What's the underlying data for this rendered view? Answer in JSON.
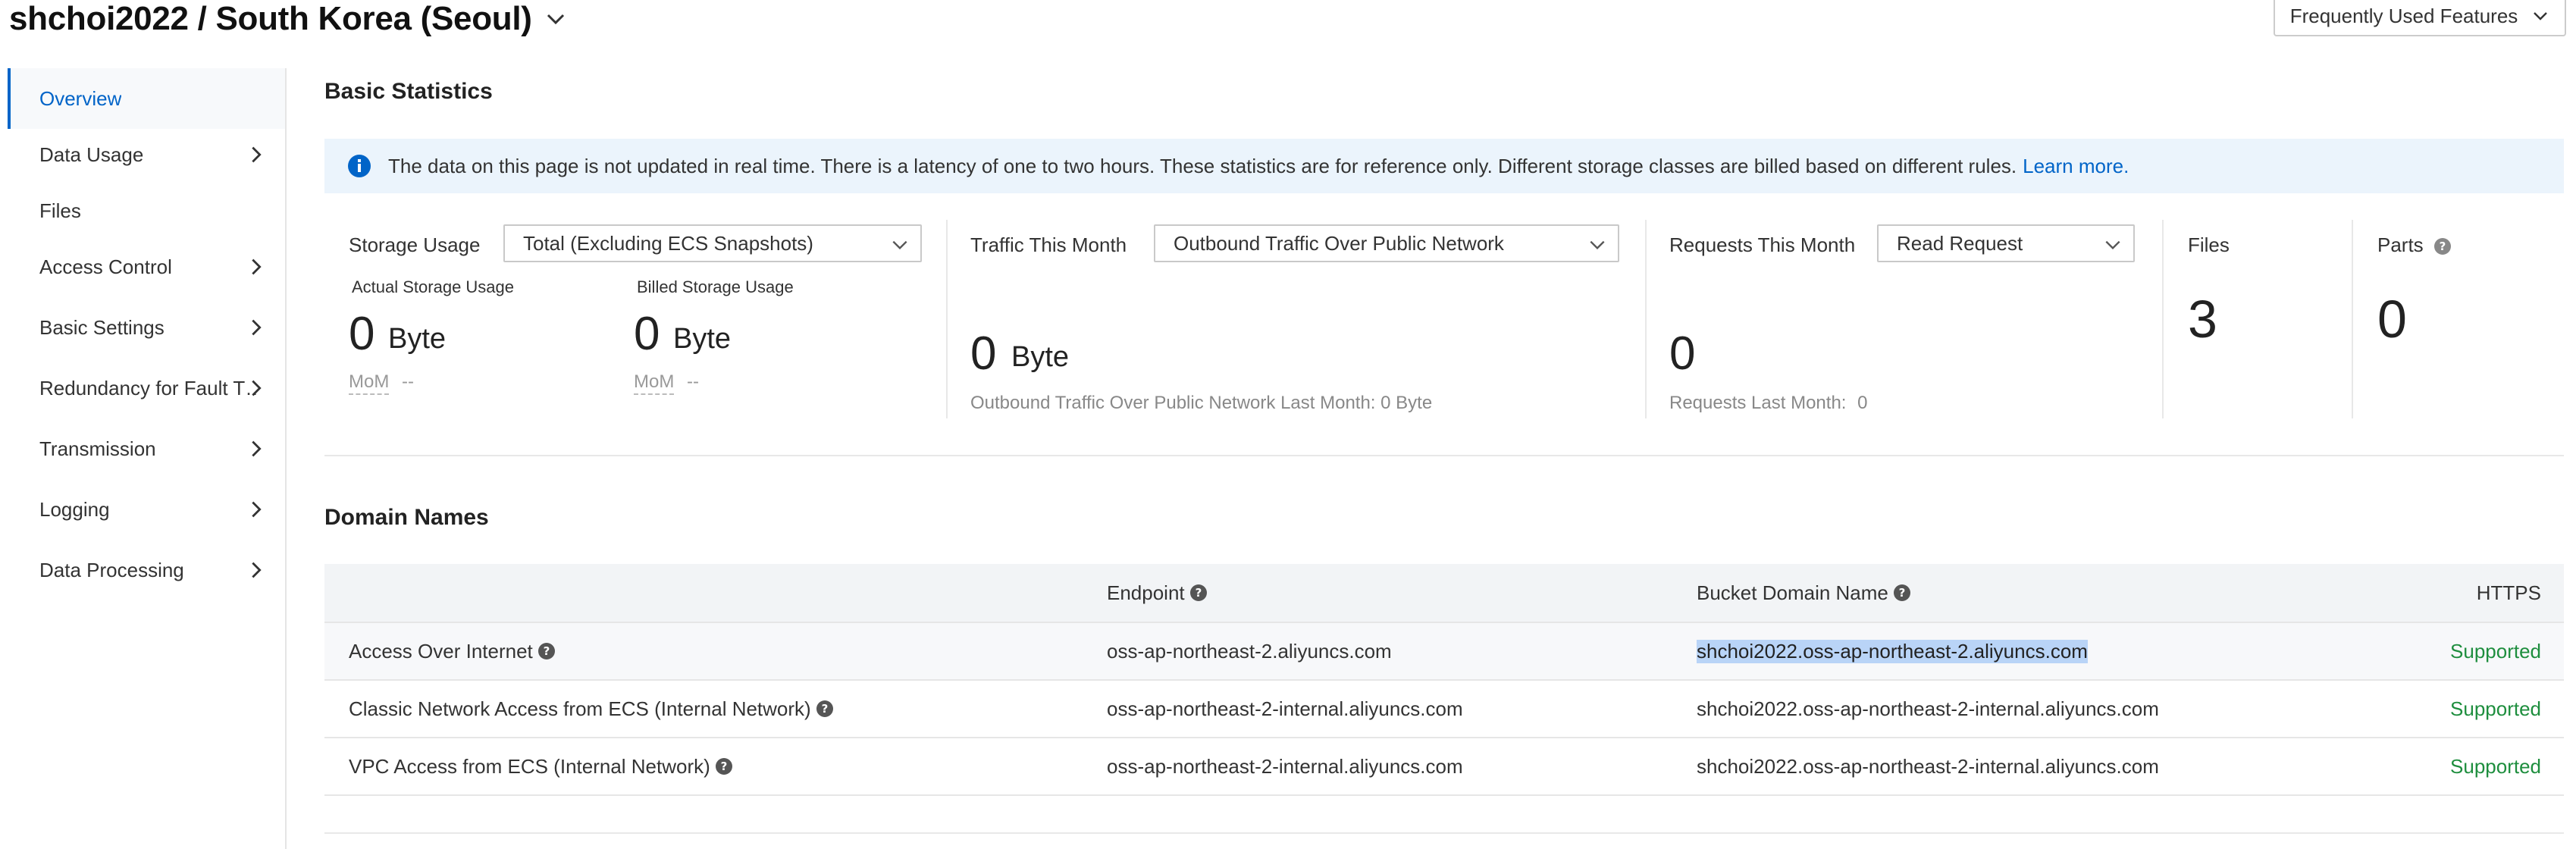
{
  "header": {
    "title": "shchoi2022 / South Korea (Seoul)",
    "frequent_features_label": "Frequently Used Features"
  },
  "sidebar": {
    "items": [
      {
        "label": "Overview",
        "active": true,
        "has_children": false
      },
      {
        "label": "Data Usage",
        "active": false,
        "has_children": true
      },
      {
        "label": "Files",
        "active": false,
        "has_children": false
      },
      {
        "label": "Access Control",
        "active": false,
        "has_children": true
      },
      {
        "label": "Basic Settings",
        "active": false,
        "has_children": true
      },
      {
        "label": "Redundancy for Fault T…",
        "active": false,
        "has_children": true
      },
      {
        "label": "Transmission",
        "active": false,
        "has_children": true
      },
      {
        "label": "Logging",
        "active": false,
        "has_children": true
      },
      {
        "label": "Data Processing",
        "active": false,
        "has_children": true
      }
    ]
  },
  "basic_statistics": {
    "title": "Basic Statistics",
    "notice": {
      "text": "The data on this page is not updated in real time. There is a latency of one to two hours. These statistics are for reference only. Different storage classes are billed based on different rules.",
      "link": "Learn more."
    },
    "storage": {
      "label": "Storage Usage",
      "select_value": "Total (Excluding ECS Snapshots)",
      "actual_label": "Actual Storage Usage",
      "actual_value": "0",
      "actual_unit": "Byte",
      "actual_mom_key": "MoM",
      "actual_mom_value": "--",
      "billed_label": "Billed Storage Usage",
      "billed_value": "0",
      "billed_unit": "Byte",
      "billed_mom_key": "MoM",
      "billed_mom_value": "--"
    },
    "traffic": {
      "label": "Traffic This Month",
      "select_value": "Outbound Traffic Over Public Network",
      "value": "0",
      "unit": "Byte",
      "last_month": "Outbound Traffic Over Public Network Last Month: 0 Byte"
    },
    "requests": {
      "label": "Requests This Month",
      "select_value": "Read Request",
      "value": "0",
      "last_month_label": "Requests Last Month:",
      "last_month_value": "0"
    },
    "files": {
      "label": "Files",
      "value": "3"
    },
    "parts": {
      "label": "Parts",
      "value": "0"
    }
  },
  "domain_names": {
    "title": "Domain Names",
    "columns": {
      "endpoint": "Endpoint",
      "bucket_domain": "Bucket Domain Name",
      "https": "HTTPS"
    },
    "rows": [
      {
        "access": "Access Over Internet",
        "endpoint": "oss-ap-northeast-2.aliyuncs.com",
        "bucket_domain": "shchoi2022.oss-ap-northeast-2.aliyuncs.com",
        "https": "Supported"
      },
      {
        "access": "Classic Network Access from ECS (Internal Network)",
        "endpoint": "oss-ap-northeast-2-internal.aliyuncs.com",
        "bucket_domain": "shchoi2022.oss-ap-northeast-2-internal.aliyuncs.com",
        "https": "Supported"
      },
      {
        "access": "VPC Access from ECS (Internal Network)",
        "endpoint": "oss-ap-northeast-2-internal.aliyuncs.com",
        "bucket_domain": "shchoi2022.oss-ap-northeast-2-internal.aliyuncs.com",
        "https": "Supported"
      }
    ]
  },
  "colors": {
    "accent": "#0064c8",
    "supported": "#1e8e3e",
    "notice_bg": "#ebf4fc",
    "selection": "#b9d4f7"
  }
}
